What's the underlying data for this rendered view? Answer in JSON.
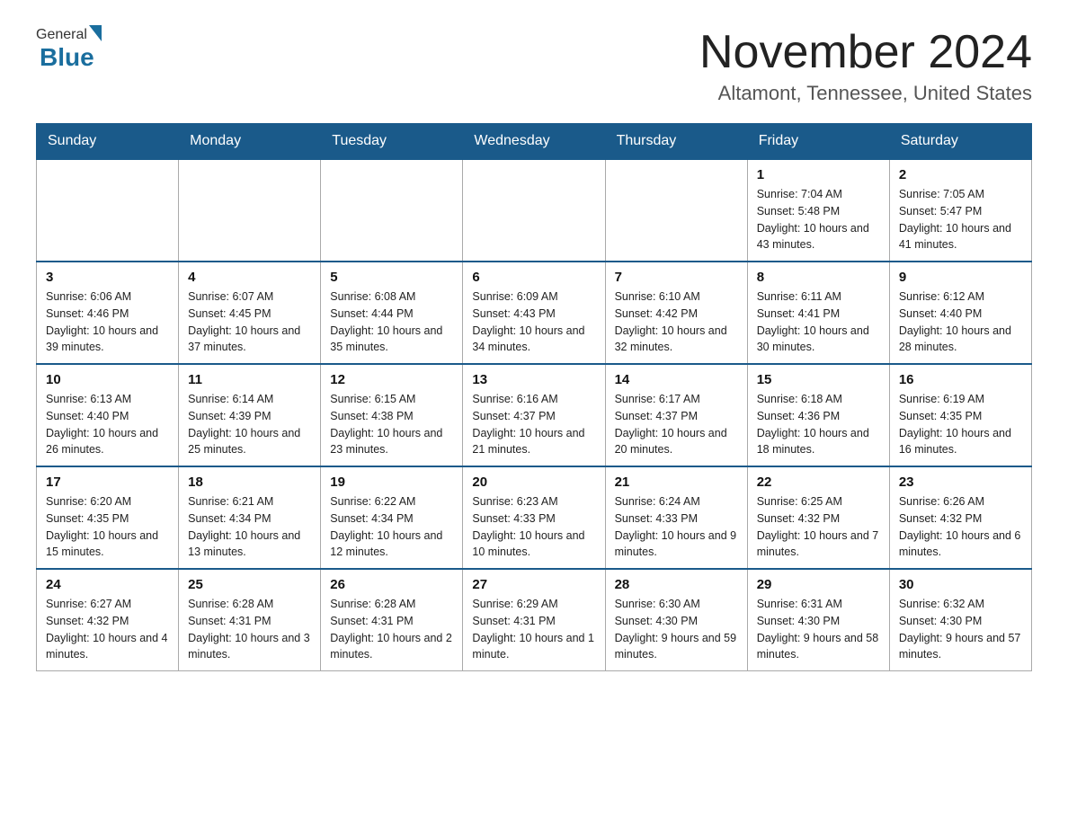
{
  "header": {
    "logo_general": "General",
    "logo_blue": "Blue",
    "month_title": "November 2024",
    "location": "Altamont, Tennessee, United States"
  },
  "weekdays": [
    "Sunday",
    "Monday",
    "Tuesday",
    "Wednesday",
    "Thursday",
    "Friday",
    "Saturday"
  ],
  "weeks": [
    [
      {
        "day": "",
        "sunrise": "",
        "sunset": "",
        "daylight": ""
      },
      {
        "day": "",
        "sunrise": "",
        "sunset": "",
        "daylight": ""
      },
      {
        "day": "",
        "sunrise": "",
        "sunset": "",
        "daylight": ""
      },
      {
        "day": "",
        "sunrise": "",
        "sunset": "",
        "daylight": ""
      },
      {
        "day": "",
        "sunrise": "",
        "sunset": "",
        "daylight": ""
      },
      {
        "day": "1",
        "sunrise": "Sunrise: 7:04 AM",
        "sunset": "Sunset: 5:48 PM",
        "daylight": "Daylight: 10 hours and 43 minutes."
      },
      {
        "day": "2",
        "sunrise": "Sunrise: 7:05 AM",
        "sunset": "Sunset: 5:47 PM",
        "daylight": "Daylight: 10 hours and 41 minutes."
      }
    ],
    [
      {
        "day": "3",
        "sunrise": "Sunrise: 6:06 AM",
        "sunset": "Sunset: 4:46 PM",
        "daylight": "Daylight: 10 hours and 39 minutes."
      },
      {
        "day": "4",
        "sunrise": "Sunrise: 6:07 AM",
        "sunset": "Sunset: 4:45 PM",
        "daylight": "Daylight: 10 hours and 37 minutes."
      },
      {
        "day": "5",
        "sunrise": "Sunrise: 6:08 AM",
        "sunset": "Sunset: 4:44 PM",
        "daylight": "Daylight: 10 hours and 35 minutes."
      },
      {
        "day": "6",
        "sunrise": "Sunrise: 6:09 AM",
        "sunset": "Sunset: 4:43 PM",
        "daylight": "Daylight: 10 hours and 34 minutes."
      },
      {
        "day": "7",
        "sunrise": "Sunrise: 6:10 AM",
        "sunset": "Sunset: 4:42 PM",
        "daylight": "Daylight: 10 hours and 32 minutes."
      },
      {
        "day": "8",
        "sunrise": "Sunrise: 6:11 AM",
        "sunset": "Sunset: 4:41 PM",
        "daylight": "Daylight: 10 hours and 30 minutes."
      },
      {
        "day": "9",
        "sunrise": "Sunrise: 6:12 AM",
        "sunset": "Sunset: 4:40 PM",
        "daylight": "Daylight: 10 hours and 28 minutes."
      }
    ],
    [
      {
        "day": "10",
        "sunrise": "Sunrise: 6:13 AM",
        "sunset": "Sunset: 4:40 PM",
        "daylight": "Daylight: 10 hours and 26 minutes."
      },
      {
        "day": "11",
        "sunrise": "Sunrise: 6:14 AM",
        "sunset": "Sunset: 4:39 PM",
        "daylight": "Daylight: 10 hours and 25 minutes."
      },
      {
        "day": "12",
        "sunrise": "Sunrise: 6:15 AM",
        "sunset": "Sunset: 4:38 PM",
        "daylight": "Daylight: 10 hours and 23 minutes."
      },
      {
        "day": "13",
        "sunrise": "Sunrise: 6:16 AM",
        "sunset": "Sunset: 4:37 PM",
        "daylight": "Daylight: 10 hours and 21 minutes."
      },
      {
        "day": "14",
        "sunrise": "Sunrise: 6:17 AM",
        "sunset": "Sunset: 4:37 PM",
        "daylight": "Daylight: 10 hours and 20 minutes."
      },
      {
        "day": "15",
        "sunrise": "Sunrise: 6:18 AM",
        "sunset": "Sunset: 4:36 PM",
        "daylight": "Daylight: 10 hours and 18 minutes."
      },
      {
        "day": "16",
        "sunrise": "Sunrise: 6:19 AM",
        "sunset": "Sunset: 4:35 PM",
        "daylight": "Daylight: 10 hours and 16 minutes."
      }
    ],
    [
      {
        "day": "17",
        "sunrise": "Sunrise: 6:20 AM",
        "sunset": "Sunset: 4:35 PM",
        "daylight": "Daylight: 10 hours and 15 minutes."
      },
      {
        "day": "18",
        "sunrise": "Sunrise: 6:21 AM",
        "sunset": "Sunset: 4:34 PM",
        "daylight": "Daylight: 10 hours and 13 minutes."
      },
      {
        "day": "19",
        "sunrise": "Sunrise: 6:22 AM",
        "sunset": "Sunset: 4:34 PM",
        "daylight": "Daylight: 10 hours and 12 minutes."
      },
      {
        "day": "20",
        "sunrise": "Sunrise: 6:23 AM",
        "sunset": "Sunset: 4:33 PM",
        "daylight": "Daylight: 10 hours and 10 minutes."
      },
      {
        "day": "21",
        "sunrise": "Sunrise: 6:24 AM",
        "sunset": "Sunset: 4:33 PM",
        "daylight": "Daylight: 10 hours and 9 minutes."
      },
      {
        "day": "22",
        "sunrise": "Sunrise: 6:25 AM",
        "sunset": "Sunset: 4:32 PM",
        "daylight": "Daylight: 10 hours and 7 minutes."
      },
      {
        "day": "23",
        "sunrise": "Sunrise: 6:26 AM",
        "sunset": "Sunset: 4:32 PM",
        "daylight": "Daylight: 10 hours and 6 minutes."
      }
    ],
    [
      {
        "day": "24",
        "sunrise": "Sunrise: 6:27 AM",
        "sunset": "Sunset: 4:32 PM",
        "daylight": "Daylight: 10 hours and 4 minutes."
      },
      {
        "day": "25",
        "sunrise": "Sunrise: 6:28 AM",
        "sunset": "Sunset: 4:31 PM",
        "daylight": "Daylight: 10 hours and 3 minutes."
      },
      {
        "day": "26",
        "sunrise": "Sunrise: 6:28 AM",
        "sunset": "Sunset: 4:31 PM",
        "daylight": "Daylight: 10 hours and 2 minutes."
      },
      {
        "day": "27",
        "sunrise": "Sunrise: 6:29 AM",
        "sunset": "Sunset: 4:31 PM",
        "daylight": "Daylight: 10 hours and 1 minute."
      },
      {
        "day": "28",
        "sunrise": "Sunrise: 6:30 AM",
        "sunset": "Sunset: 4:30 PM",
        "daylight": "Daylight: 9 hours and 59 minutes."
      },
      {
        "day": "29",
        "sunrise": "Sunrise: 6:31 AM",
        "sunset": "Sunset: 4:30 PM",
        "daylight": "Daylight: 9 hours and 58 minutes."
      },
      {
        "day": "30",
        "sunrise": "Sunrise: 6:32 AM",
        "sunset": "Sunset: 4:30 PM",
        "daylight": "Daylight: 9 hours and 57 minutes."
      }
    ]
  ]
}
